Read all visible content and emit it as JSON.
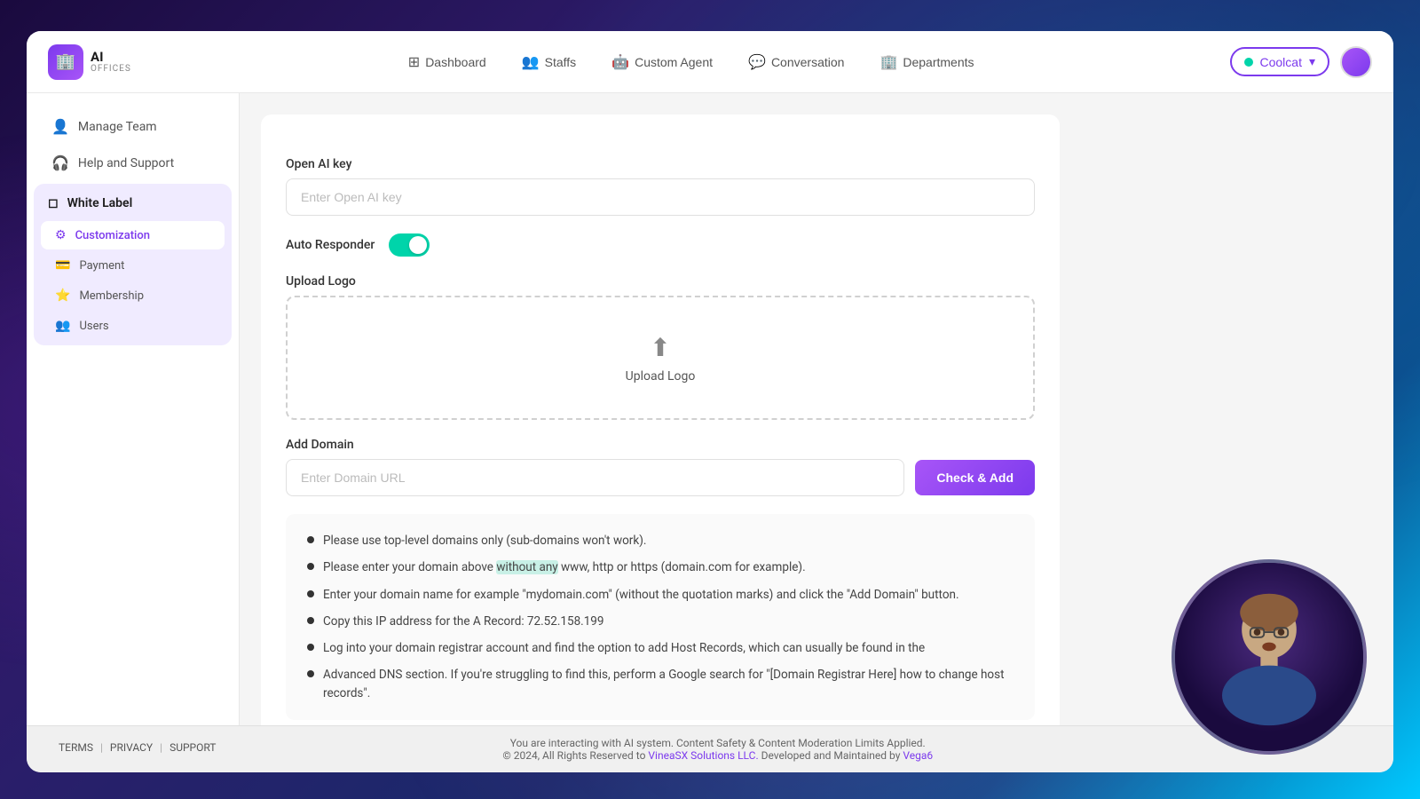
{
  "app": {
    "logo_text": "AI",
    "logo_sub": "OFFICES",
    "window_title": "AI Offices"
  },
  "nav": {
    "tabs": [
      {
        "id": "dashboard",
        "label": "Dashboard",
        "icon": "⊞",
        "active": false
      },
      {
        "id": "staffs",
        "label": "Staffs",
        "icon": "👥",
        "active": false
      },
      {
        "id": "custom-agent",
        "label": "Custom Agent",
        "icon": "🤖",
        "active": false
      },
      {
        "id": "conversation",
        "label": "Conversation",
        "icon": "💬",
        "active": false
      },
      {
        "id": "departments",
        "label": "Departments",
        "icon": "🏢",
        "active": false
      }
    ],
    "user_button_label": "Coolcat",
    "user_button_chevron": "▾"
  },
  "sidebar": {
    "manage_team_label": "Manage Team",
    "help_support_label": "Help and Support",
    "white_label_label": "White Label",
    "sub_items": [
      {
        "id": "customization",
        "label": "Customization",
        "active": true
      },
      {
        "id": "payment",
        "label": "Payment",
        "active": false
      },
      {
        "id": "membership",
        "label": "Membership",
        "active": false
      },
      {
        "id": "users",
        "label": "Users",
        "active": false
      }
    ]
  },
  "main": {
    "open_ai_key_label": "Open AI key",
    "open_ai_key_placeholder": "Enter Open AI key",
    "auto_responder_label": "Auto Responder",
    "upload_logo_label": "Upload Logo",
    "upload_logo_btn_label": "Upload Logo",
    "add_domain_label": "Add Domain",
    "domain_input_placeholder": "Enter Domain URL",
    "check_add_btn": "Check & Add",
    "info_items": [
      "Please use top-level domains only (sub-domains won't work).",
      "Please enter your domain above without any www, http or https (domain.com for example).",
      "Enter your domain name for example \"mydomain.com\" (without the quotation marks) and click the \"Add Domain\" button.",
      "Copy this IP address for the A Record: 72.52.158.199",
      "Log into your domain registrar account and find the option to add Host Records, which can usually be found in the",
      "Advanced DNS section. If you're struggling to find this, perform a Google search for \"[Domain Registrar Here] how to change host records\"."
    ]
  },
  "footer": {
    "terms": "TERMS",
    "privacy": "PRIVACY",
    "support": "SUPPORT",
    "copyright_line1": "You are interacting with AI system. Content Safety & Content Moderation Limits Applied.",
    "copyright_line2": "© 2024, All Rights Reserved to",
    "company": "VineaSX Solutions LLC.",
    "developed_by": "Developed and Maintained by",
    "developer": "Vega6"
  }
}
